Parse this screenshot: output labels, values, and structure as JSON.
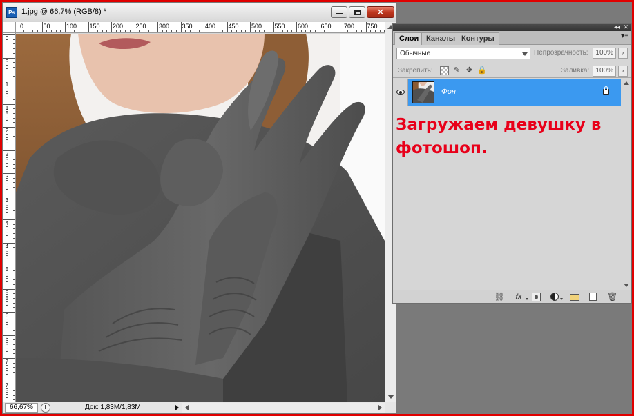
{
  "document": {
    "app_icon": "Ps",
    "title": "1.jpg @ 66,7% (RGB/8) *",
    "close_glyph": "✕",
    "ruler_h_labels": [
      "0",
      "50",
      "100",
      "150",
      "200",
      "250",
      "300",
      "350",
      "400",
      "450",
      "500",
      "550",
      "600",
      "650",
      "700",
      "750"
    ],
    "ruler_v_labels": [
      "0",
      "50",
      "100",
      "150",
      "200",
      "250",
      "300",
      "350",
      "400",
      "450",
      "500",
      "550",
      "600",
      "650",
      "700",
      "750"
    ],
    "status": {
      "zoom": "66,67%",
      "doc_info": "Док: 1,83M/1,83M"
    }
  },
  "layers_panel": {
    "collapse_glyph": "◂◂",
    "close_glyph": "✕",
    "menu_glyph": "▾≡",
    "tabs": [
      {
        "label": "Слои",
        "active": true
      },
      {
        "label": "Каналы",
        "active": false
      },
      {
        "label": "Контуры",
        "active": false
      }
    ],
    "blend_mode": "Обычные",
    "opacity_label": "Непрозрачность:",
    "opacity_value": "100%",
    "lock_label": "Закрепить:",
    "fill_label": "Заливка:",
    "fill_value": "100%",
    "field_arrow_glyph": "›",
    "lock_icons": {
      "brush": "✎",
      "move": "✥",
      "all": "🔒"
    },
    "layers": [
      {
        "name": "Фон",
        "selected": true,
        "visible": true,
        "locked": true
      }
    ],
    "bottom_icons": {
      "link": "⛓",
      "fx": "fx",
      "trash": "🗑"
    }
  },
  "annotation": "Загружаем девушку в фотошоп.",
  "colors": {
    "frame": "#e00000",
    "annotation": "#e8001a",
    "selection": "#3b99f0",
    "workspace": "#7a7a7a"
  }
}
